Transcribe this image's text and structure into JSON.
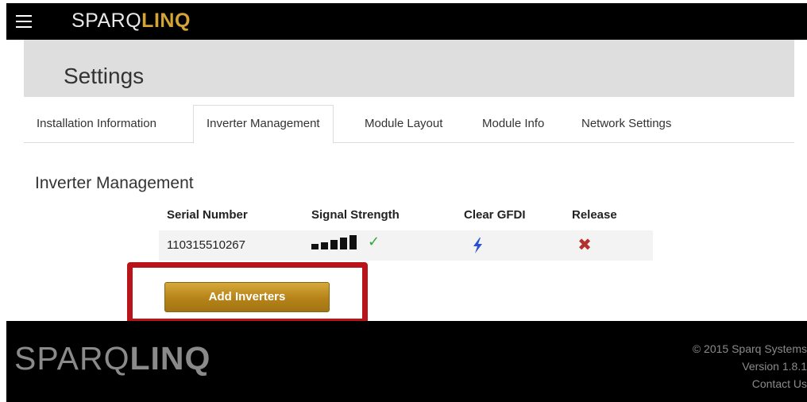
{
  "header": {
    "menu_icon": "hamburger-icon",
    "logo_light": "SPARQ",
    "logo_bold": "LINQ",
    "logo_bold_color": "#d4a437"
  },
  "page": {
    "title": "Settings"
  },
  "tabs": [
    {
      "label": "Installation Information",
      "active": false
    },
    {
      "label": "Inverter Management",
      "active": true
    },
    {
      "label": "Module Layout",
      "active": false
    },
    {
      "label": "Module Info",
      "active": false
    },
    {
      "label": "Network Settings",
      "active": false
    }
  ],
  "inverter_management": {
    "title": "Inverter Management",
    "columns": [
      "Serial Number",
      "Signal Strength",
      "Clear GFDI",
      "Release"
    ],
    "rows": [
      {
        "serial_number": "110315510267",
        "signal_strength": {
          "bars": 5,
          "max": 5,
          "icon": "checkmark-icon",
          "status_color": "#2daa3d"
        },
        "clear_gfdi_icon": "lightning-bolt-icon",
        "release_icon": "x-icon",
        "release_color": "#b3312c"
      }
    ],
    "add_button_label": "Add Inverters",
    "highlight_color": "#b81419"
  },
  "footer": {
    "logo_light": "SPARQ",
    "logo_bold": "LINQ",
    "copyright": "© 2015 Sparq Systems",
    "version": "Version 1.8.1",
    "contact": "Contact Us"
  }
}
